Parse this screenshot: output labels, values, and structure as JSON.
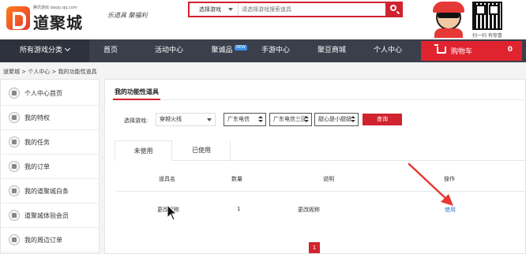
{
  "header": {
    "logo_sub": "腾讯游戏 daoju.qq.com",
    "logo_name": "道聚城",
    "slogan": "乐道具 聚福利",
    "search": {
      "type_label": "选择游戏",
      "placeholder": "请选择游戏搜索道具"
    },
    "qr_caption": "扫一扫  有惊喜"
  },
  "nav": {
    "all_games": "所有游戏分类",
    "items": [
      "首页",
      "活动中心",
      "聚诚品",
      "手游中心",
      "聚豆商城",
      "个人中心"
    ],
    "new_badge": "NEW",
    "cart_label": "购物车",
    "cart_count": "0"
  },
  "breadcrumb": "道聚城 > 个人中心 > 我的功能性道具",
  "sidebar": {
    "items": [
      "个人中心首页",
      "我的特权",
      "我的任务",
      "我的订单",
      "我的道聚城白条",
      "道聚城体验会员",
      "我的周边订单"
    ]
  },
  "main": {
    "title": "我的功能性道具",
    "filter_label": "选择游戏:",
    "game_select": "穿越火线",
    "region_select": "广东电信",
    "server_select": "广东电信三区",
    "role_select": "甜心是小甜妞",
    "query_button": "查询",
    "tabs": [
      "未使用",
      "已使用"
    ],
    "columns": [
      "道具名",
      "数量",
      "说明",
      "操作"
    ],
    "rows": [
      {
        "name": "更改昵称",
        "qty": "1",
        "desc": "更改昵称",
        "action": "使用"
      }
    ],
    "page": "1"
  },
  "colors": {
    "brand_red": "#d0232f",
    "nav_bg": "#3a3f4b",
    "link_blue": "#2a7ad8"
  }
}
